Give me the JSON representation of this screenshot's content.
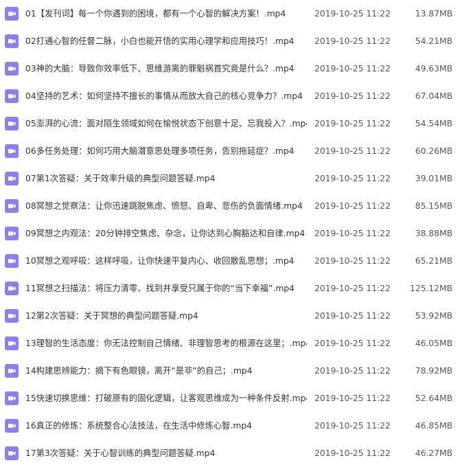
{
  "colors": {
    "icon_background": "#8b7ff2",
    "icon_glyph": "#ffffff",
    "text": "#333333"
  },
  "files": [
    {
      "name": "01【发刊词】每一个你遇到的困境，都有一个心智的解决方案！.mp4",
      "date": "2019-10-25 11:22",
      "size": "13.87MB",
      "icon": "video-file-icon"
    },
    {
      "name": "02打通心智的任督二脉，小白也能开悟的实用心理学和应用技巧！.mp4",
      "date": "2019-10-25 11:22",
      "size": "54.21MB",
      "icon": "video-file-icon"
    },
    {
      "name": "03神的大脑：导致你效率低下、思维游离的罪魁祸首究竟是什么？.mp4",
      "date": "2019-10-25 11:22",
      "size": "49.63MB",
      "icon": "video-file-icon"
    },
    {
      "name": "04坚持的艺术：如何坚持不擅长的事情从而放大自己的核心竞争力？.mp4",
      "date": "2019-10-25 11:22",
      "size": "67.04MB",
      "icon": "video-file-icon"
    },
    {
      "name": "05澎湃的心流：面对陌生领域如何在愉悦状态下创意十足、忘我投入？.mp4",
      "date": "2019-10-25 11:22",
      "size": "54.54MB",
      "icon": "video-file-icon"
    },
    {
      "name": "06多任务处理：如何巧用大脑潜意思处理多项任务，告别拖延症？.mp4",
      "date": "2019-10-25 11:22",
      "size": "60.26MB",
      "icon": "video-file-icon"
    },
    {
      "name": "07第1次答疑：关于效率升级的典型问题答疑.mp4",
      "date": "2019-10-25 11:22",
      "size": "39.01MB",
      "icon": "video-file-icon"
    },
    {
      "name": "08冥想之觉察法：让你迅速跳脱焦虑、愤怒、自卑、悲伤的负面情绪.mp4",
      "date": "2019-10-25 11:22",
      "size": "85.15MB",
      "icon": "video-file-icon"
    },
    {
      "name": "09冥想之内观法：20分钟排空焦虑、杂念，让你达到心胸豁达和自律.mp4",
      "date": "2019-10-25 11:22",
      "size": "38.88MB",
      "icon": "video-file-icon"
    },
    {
      "name": "10冥想之观呼吸：这样呼吸，让你快速平复内心、收回散乱思想；.mp4",
      "date": "2019-10-25 11:22",
      "size": "65.21MB",
      "icon": "video-file-icon"
    },
    {
      "name": "11冥想之扫描法：将压力清零、找到并享受只属于你的“当下幸福”.mp4",
      "date": "2019-10-25 11:22",
      "size": "125.12MB",
      "icon": "video-file-icon"
    },
    {
      "name": "12第2次答疑：关于冥想的典型问题答疑.mp4",
      "date": "2019-10-25 11:22",
      "size": "53.92MB",
      "icon": "video-file-icon"
    },
    {
      "name": "13理智的生活态度：你无法控制自己情绪、非理智思考的根源在这里；.mp4",
      "date": "2019-10-25 11:22",
      "size": "46.05MB",
      "icon": "video-file-icon"
    },
    {
      "name": "14构建思辨能力：摘下有色眼镜，离开“是非”的自己；.mp4",
      "date": "2019-10-25 11:22",
      "size": "78.92MB",
      "icon": "video-file-icon"
    },
    {
      "name": "15快速切换思维：打破原有的固化逻辑，让客观思维成为一种条件反射.mp4",
      "date": "2019-10-25 11:22",
      "size": "52.64MB",
      "icon": "video-file-icon"
    },
    {
      "name": "16真正的修炼：系统整合心法技法，在生活中修炼心智.mp4",
      "date": "2019-10-25 11:22",
      "size": "46.85MB",
      "icon": "video-file-icon"
    },
    {
      "name": "17第3次答疑：关于心智训练的典型问题答疑.mp4",
      "date": "2019-10-25 11:22",
      "size": "46.27MB",
      "icon": "video-file-icon"
    }
  ]
}
